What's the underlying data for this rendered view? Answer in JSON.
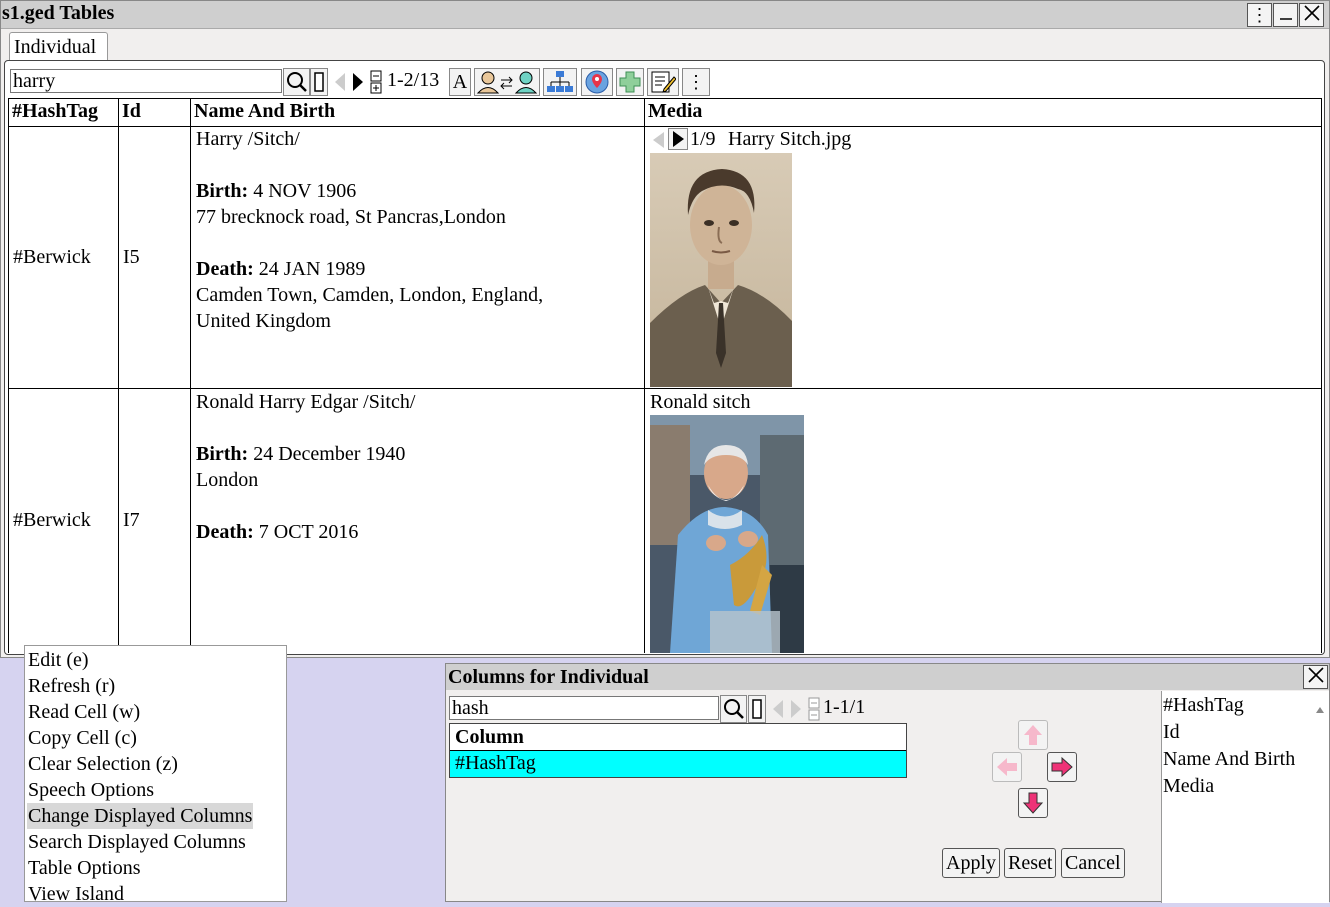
{
  "window": {
    "title": "s1.ged Tables",
    "tab": "Individual"
  },
  "toolbar": {
    "search_value": "harry",
    "count": "1-2/13",
    "font_button": "A"
  },
  "table": {
    "headers": [
      "#HashTag",
      "Id",
      "Name And Birth",
      "Media"
    ],
    "rows": [
      {
        "hashtag": "#Berwick",
        "id": "I5",
        "name": "Harry /Sitch/",
        "birth_label": "Birth:",
        "birth_date": "4 NOV 1906",
        "birth_place": "77 brecknock road, St Pancras,London",
        "death_label": "Death:",
        "death_date": "24 JAN 1989",
        "death_place_1": "Camden Town, Camden, London, England,",
        "death_place_2": "United Kingdom",
        "media_counter": "1/9",
        "media_title": "Harry Sitch.jpg"
      },
      {
        "hashtag": "#Berwick",
        "id": "I7",
        "name": "Ronald Harry Edgar /Sitch/",
        "birth_label": "Birth:",
        "birth_date": "24 December 1940",
        "birth_place": "London",
        "death_label": "Death:",
        "death_date": "7 OCT 2016",
        "media_title": "Ronald sitch"
      }
    ]
  },
  "context_menu": {
    "items": [
      "Edit (e)",
      "Refresh (r)",
      "Read Cell (w)",
      "Copy Cell (c)",
      "Clear Selection (z)",
      "Speech Options",
      "Change Displayed Columns",
      "Search Displayed Columns",
      "Table Options",
      "View Island"
    ],
    "selected": "Change Displayed Columns"
  },
  "columns_dialog": {
    "title": "Columns for Individual",
    "search_value": "hash",
    "count": "1-1/1",
    "table_header": "Column",
    "table_rows": [
      "#HashTag"
    ],
    "selected_color": "#00ffff",
    "displayed_columns": [
      "#HashTag",
      "Id",
      "Name And Birth",
      "Media"
    ],
    "apply": "Apply",
    "reset": "Reset",
    "cancel": "Cancel"
  },
  "colors": {
    "background": "#d6d3f0",
    "titlebar": "#cfcfcf",
    "window": "#f1efee",
    "arrow_active": "#ee3377"
  }
}
